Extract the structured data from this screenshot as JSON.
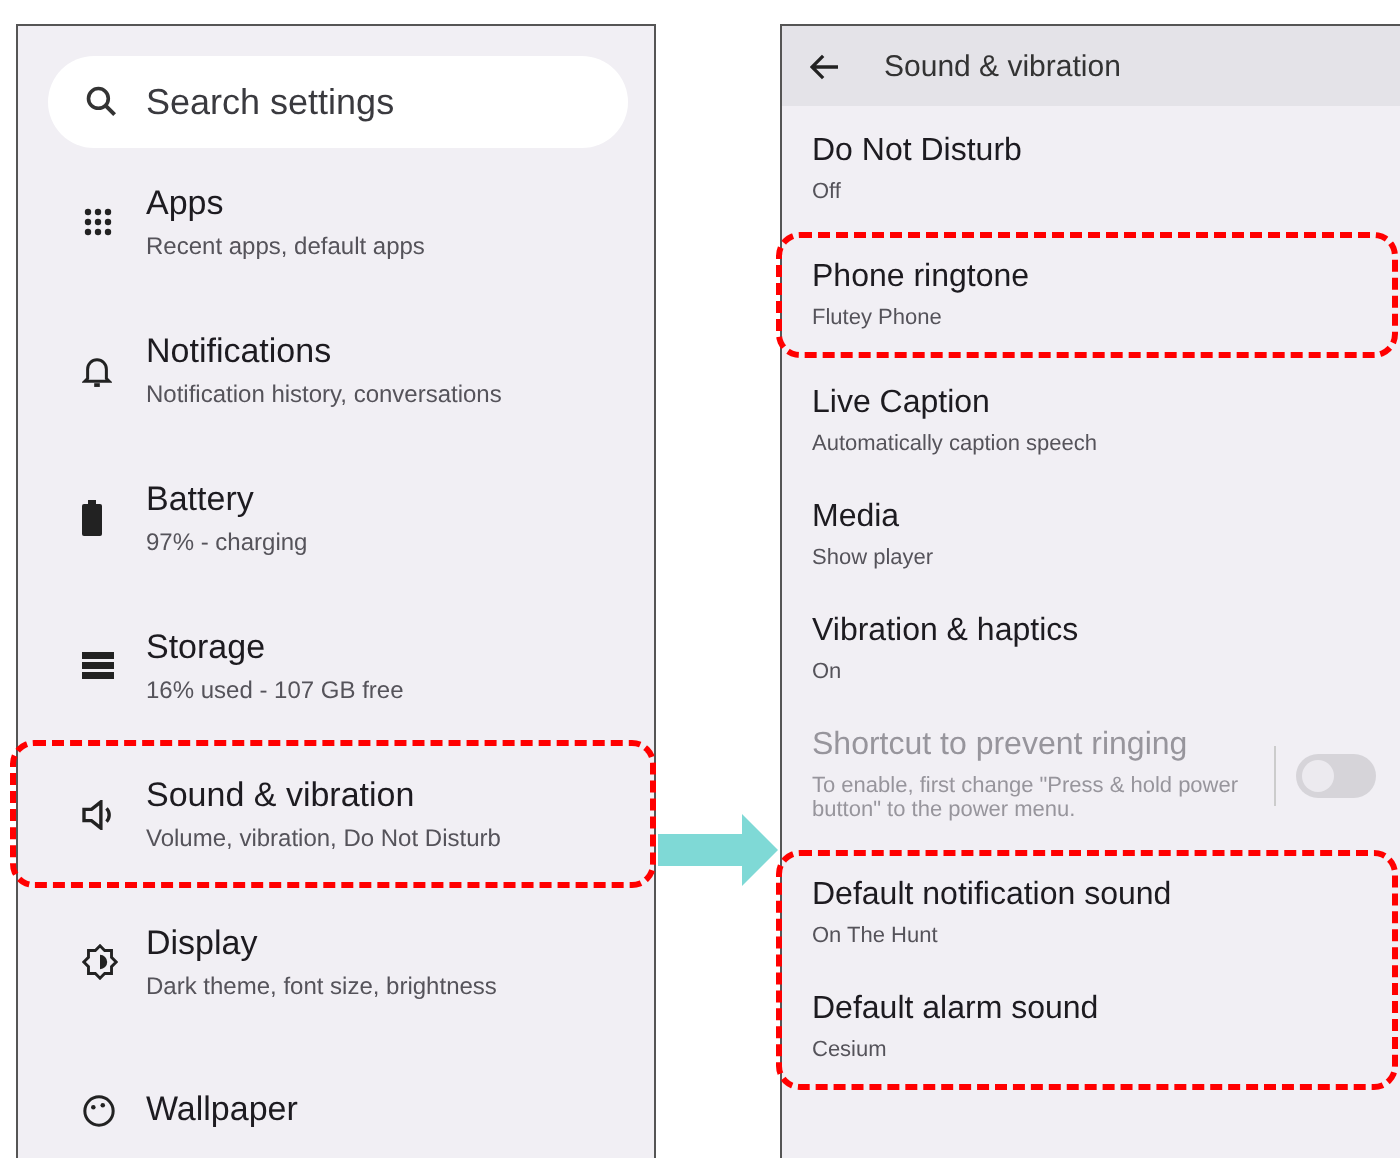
{
  "left": {
    "search": {
      "placeholder": "Search settings"
    },
    "items": [
      {
        "kind": "apps",
        "title": "Apps",
        "subtitle": "Recent apps, default apps",
        "highlighted": false
      },
      {
        "kind": "bell",
        "title": "Notifications",
        "subtitle": "Notification history, conversations",
        "highlighted": false
      },
      {
        "kind": "battery",
        "title": "Battery",
        "subtitle": "97% - charging",
        "highlighted": false
      },
      {
        "kind": "storage",
        "title": "Storage",
        "subtitle": "16% used - 107 GB free",
        "highlighted": false
      },
      {
        "kind": "sound",
        "title": "Sound & vibration",
        "subtitle": "Volume, vibration, Do Not Disturb",
        "highlighted": true
      },
      {
        "kind": "display",
        "title": "Display",
        "subtitle": "Dark theme, font size, brightness",
        "highlighted": false
      },
      {
        "kind": "wallpaper",
        "title": "Wallpaper",
        "highlighted": false
      }
    ]
  },
  "right": {
    "header": {
      "title": "Sound & vibration"
    },
    "groups": [
      {
        "highlighted": false,
        "items": [
          {
            "kind": "link",
            "title": "Do Not Disturb",
            "subtitle": "Off",
            "disabled": false
          }
        ]
      },
      {
        "highlighted": true,
        "items": [
          {
            "kind": "link",
            "title": "Phone ringtone",
            "subtitle": "Flutey Phone",
            "disabled": false
          }
        ]
      },
      {
        "highlighted": false,
        "items": [
          {
            "kind": "link",
            "title": "Live Caption",
            "subtitle": "Automatically caption speech",
            "disabled": false
          },
          {
            "kind": "link",
            "title": "Media",
            "subtitle": "Show player",
            "disabled": false
          },
          {
            "kind": "link",
            "title": "Vibration & haptics",
            "subtitle": "On",
            "disabled": false
          },
          {
            "kind": "switch",
            "title": "Shortcut to prevent ringing",
            "subtitle": "To enable, first change \"Press & hold power button\" to the power menu.",
            "disabled": true,
            "on": false
          }
        ]
      },
      {
        "highlighted": true,
        "items": [
          {
            "kind": "link",
            "title": "Default notification sound",
            "subtitle": "On The Hunt",
            "disabled": false
          },
          {
            "kind": "link",
            "title": "Default alarm sound",
            "subtitle": "Cesium",
            "disabled": false
          }
        ]
      }
    ]
  }
}
